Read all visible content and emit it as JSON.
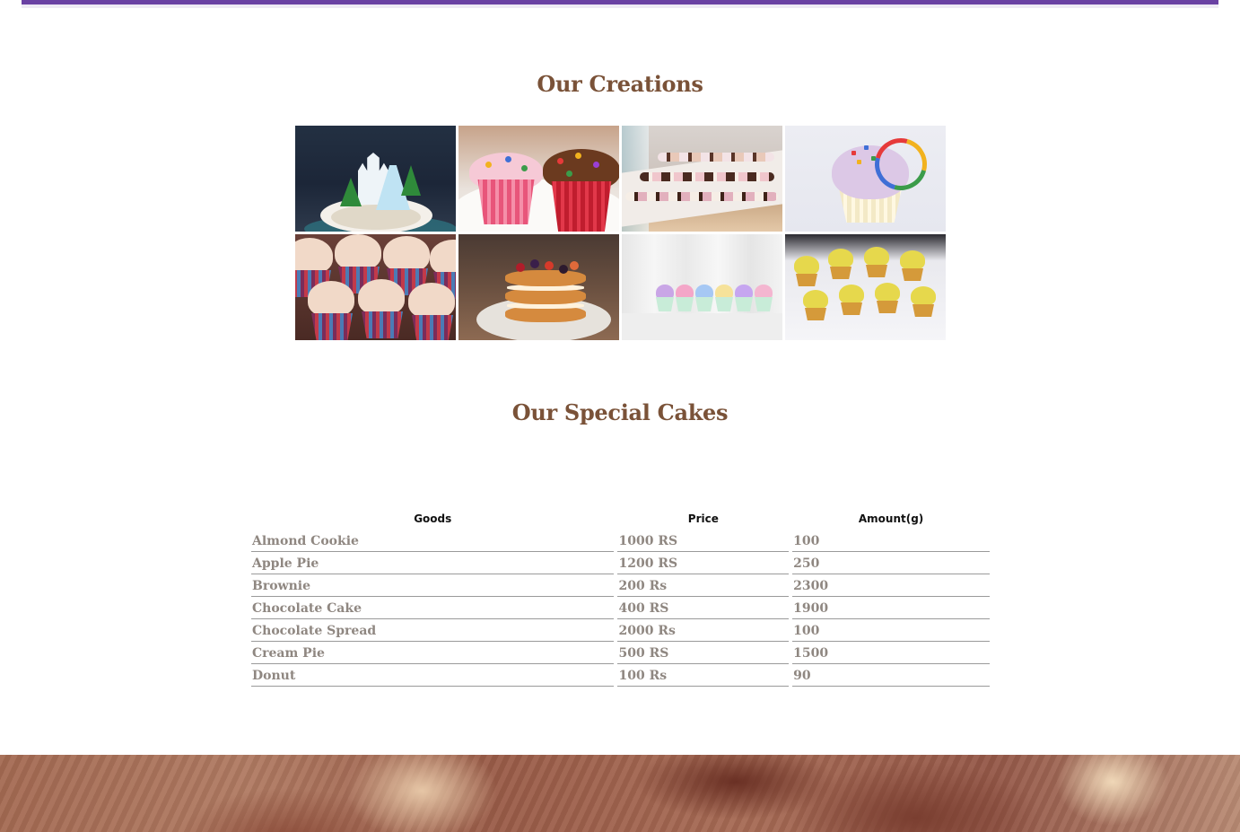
{
  "sections": {
    "creations_title": "Our Creations",
    "special_title": "Our Special Cakes"
  },
  "gallery": [
    {
      "name": "frozen-castle-cake"
    },
    {
      "name": "candy-cupcakes"
    },
    {
      "name": "cupcake-display"
    },
    {
      "name": "rainbow-cupcake"
    },
    {
      "name": "frosted-cupcakes"
    },
    {
      "name": "berry-naked-cake"
    },
    {
      "name": "pastel-cupcakes"
    },
    {
      "name": "daisy-cupcakes"
    }
  ],
  "table": {
    "headers": [
      "Goods",
      "Price",
      "Amount(g)"
    ],
    "rows": [
      [
        "Almond Cookie",
        "1000 RS",
        "100"
      ],
      [
        "Apple Pie",
        "1200 RS",
        "250"
      ],
      [
        "Brownie",
        "200 Rs",
        "2300"
      ],
      [
        "Chocolate Cake",
        "400 RS",
        "1900"
      ],
      [
        "Chocolate Spread",
        "2000 Rs",
        "100"
      ],
      [
        "Cream Pie",
        "500 RS",
        "1500"
      ],
      [
        "Donut",
        "100 Rs",
        "90"
      ]
    ]
  },
  "colors": {
    "accent_bar": "#6a41a3",
    "title": "#7a5238",
    "cell_text": "#8f8781"
  }
}
